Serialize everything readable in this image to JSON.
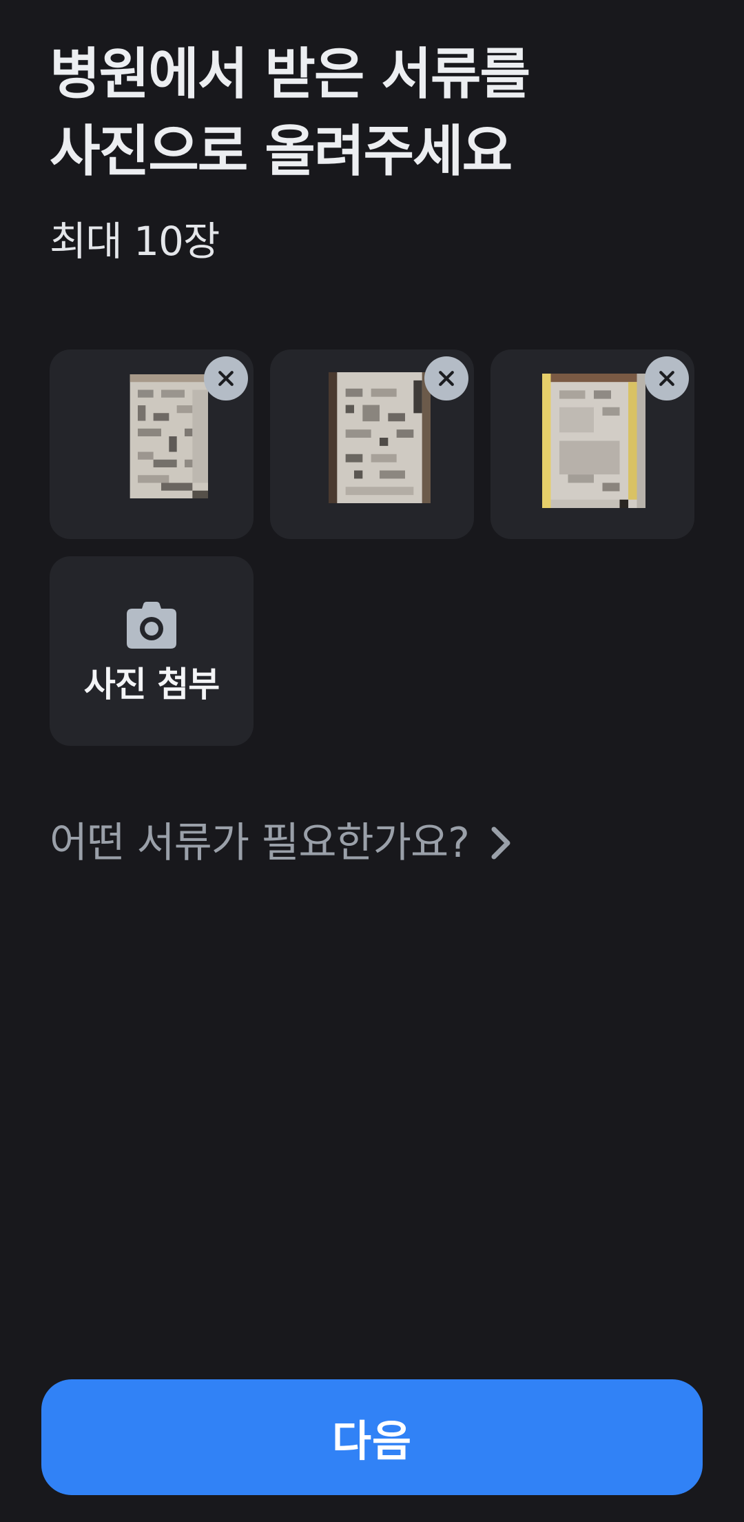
{
  "header": {
    "title_line1": "병원에서 받은 서류를",
    "title_line2": "사진으로 올려주세요",
    "subtitle": "최대 10장"
  },
  "photos": [
    {
      "name": "document-photo-1",
      "remove_icon": "close-icon"
    },
    {
      "name": "document-photo-2",
      "remove_icon": "close-icon"
    },
    {
      "name": "document-photo-3",
      "remove_icon": "close-icon"
    }
  ],
  "add_photo": {
    "icon": "camera-icon",
    "label": "사진 첨부"
  },
  "help": {
    "text": "어떤 서류가 필요한가요?",
    "icon": "chevron-right-icon"
  },
  "footer": {
    "next_label": "다음"
  },
  "colors": {
    "background": "#18181c",
    "tile": "#24252a",
    "accent": "#3182f6",
    "muted_text": "#9aa0a9",
    "remove_button": "#b4bcc6"
  }
}
